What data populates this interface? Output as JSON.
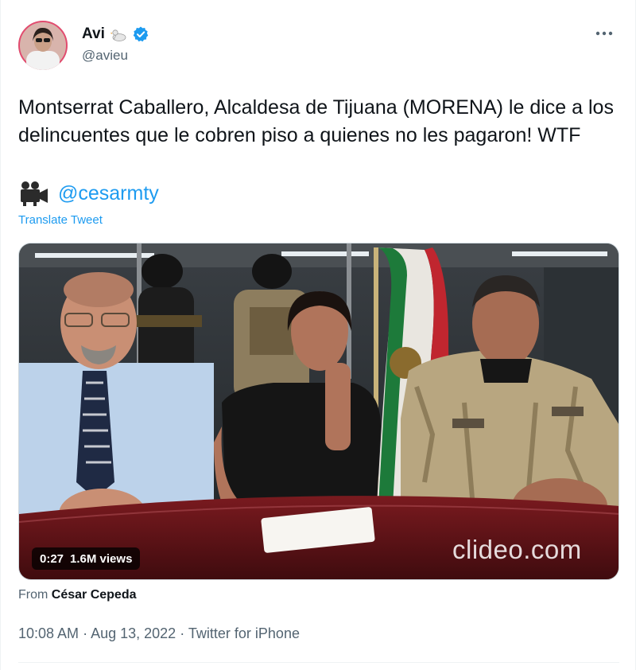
{
  "author": {
    "display_name": "Avi",
    "handle": "@avieu",
    "verified": true,
    "name_emoji": "duck-icon",
    "avatar": "avatar-photo"
  },
  "tweet": {
    "text": "Montserrat Caballero, Alcaldesa de Tijuana (MORENA) le dice a los delincuentes que le cobren piso a quienes no les pagaron! WTF",
    "mention_icon": "movie-camera-icon",
    "mention": "@cesarmty",
    "translate_label": "Translate Tweet"
  },
  "media": {
    "type": "video",
    "duration": "0:27",
    "views": "1.6M views",
    "watermark": "clideo.com"
  },
  "attribution": {
    "prefix": "From",
    "source": "César Cepeda"
  },
  "meta": {
    "time": "10:08 AM",
    "separator": "·",
    "date": "Aug 13, 2022",
    "client": "Twitter for iPhone"
  },
  "colors": {
    "link": "#1d9bf0",
    "secondary_text": "#536471",
    "verified": "#1d9bf0"
  }
}
